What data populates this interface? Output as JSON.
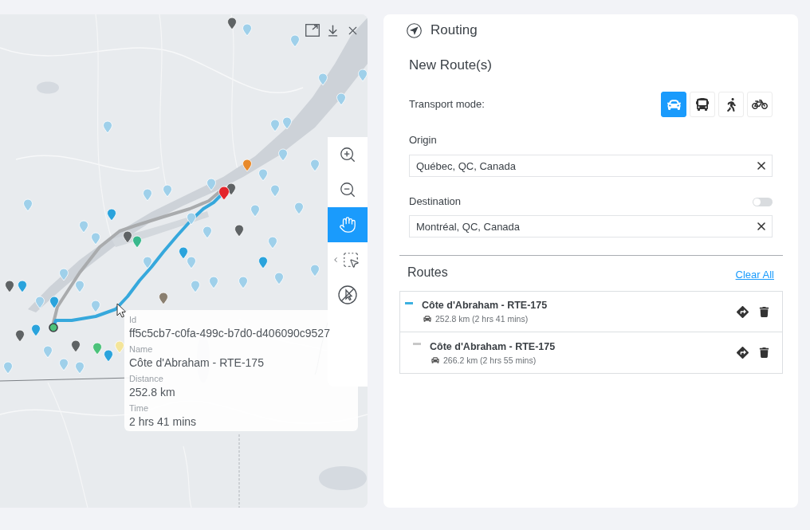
{
  "map": {
    "tools": [
      {
        "kind": "zoom_in",
        "selected": false
      },
      {
        "kind": "zoom_out",
        "selected": false
      },
      {
        "kind": "pan",
        "selected": true
      },
      {
        "kind": "select_area",
        "selected": false
      },
      {
        "kind": "touch_off",
        "selected": false
      }
    ],
    "tooltip": {
      "fields": [
        {
          "label": "Id",
          "value": "ff5c5cb7-c0fa-499c-b7d0-d406090c9527"
        },
        {
          "label": "Name",
          "value": "Côte d'Abraham - RTE-175"
        },
        {
          "label": "Distance",
          "value": "252.8 km"
        },
        {
          "label": "Time",
          "value": "2 hrs 41 mins"
        }
      ]
    }
  },
  "routing": {
    "title": "Routing",
    "section_title": "New Route(s)",
    "transport": {
      "label": "Transport mode:",
      "modes": [
        {
          "kind": "car",
          "selected": true
        },
        {
          "kind": "bus",
          "selected": false
        },
        {
          "kind": "walk",
          "selected": false
        },
        {
          "kind": "bike",
          "selected": false
        }
      ]
    },
    "origin": {
      "label": "Origin",
      "value": "Québec, QC, Canada"
    },
    "destination": {
      "label": "Destination",
      "value": "Montréal, QC, Canada",
      "switch": {
        "on": false
      }
    }
  },
  "routes": {
    "title": "Routes",
    "clear_all": "Clear All",
    "items": [
      {
        "kind": "main",
        "name": "Côte d'Abraham - RTE-175",
        "summary": "252.8 km (2 hrs 41 mins)",
        "color": "#3cb0e0"
      },
      {
        "kind": "alternative",
        "name": "Côte d'Abraham - RTE-175",
        "summary": "266.2 km (2 hrs 55 mins)",
        "color": "#c8c8c8"
      }
    ]
  }
}
